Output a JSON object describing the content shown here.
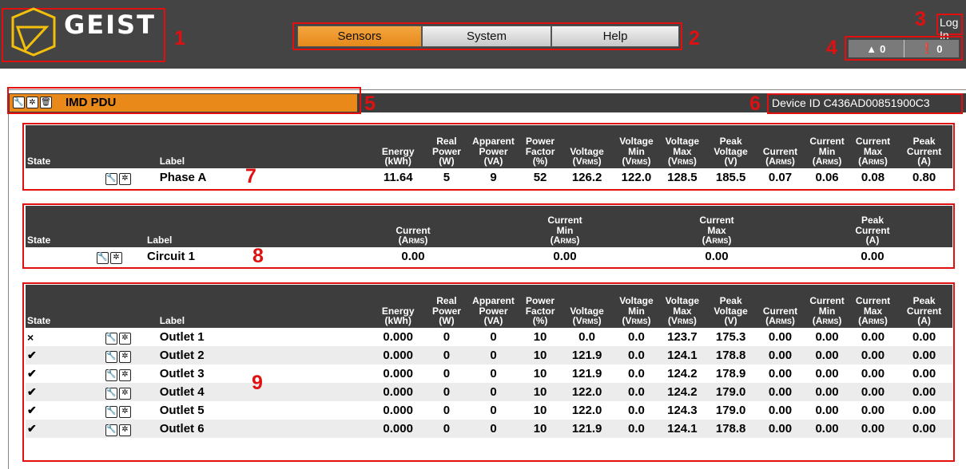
{
  "callouts": [
    "1",
    "2",
    "3",
    "4",
    "5",
    "6",
    "7",
    "8",
    "9"
  ],
  "brand": {
    "name": "GEIST",
    "logo_color": "#f2c00c"
  },
  "nav": {
    "tabs": [
      {
        "label": "Sensors",
        "active": true
      },
      {
        "label": "System",
        "active": false
      },
      {
        "label": "Help",
        "active": false
      }
    ]
  },
  "login": {
    "label": "Log In"
  },
  "alerts": {
    "warnings": "0",
    "alarms": "0",
    "warning_icon": "warning-triangle-icon",
    "alarm_icon": "exclamation-circle-icon"
  },
  "pdu": {
    "name": "IMD PDU",
    "device_id": "Device ID C436AD00851900C3",
    "icons": [
      "wrench-icon",
      "gear-icon",
      "trash-icon"
    ]
  },
  "phase_table": {
    "headers": {
      "state": "State",
      "label": "Label",
      "energy": [
        "Energy",
        "(kWh)"
      ],
      "real_power": [
        "Real",
        "Power",
        "(W)"
      ],
      "apparent_power": [
        "Apparent",
        "Power",
        "(VA)"
      ],
      "power_factor": [
        "Power",
        "Factor",
        "(%)"
      ],
      "voltage": [
        "Voltage",
        "(V",
        "RMS",
        ")"
      ],
      "voltage_min": [
        "Voltage",
        "Min",
        "(V",
        "RMS",
        ")"
      ],
      "voltage_max": [
        "Voltage",
        "Max",
        "(V",
        "RMS",
        ")"
      ],
      "peak_voltage": [
        "Peak",
        "Voltage",
        "(V)"
      ],
      "current": [
        "Current",
        "(A",
        "RMS",
        ")"
      ],
      "current_min": [
        "Current",
        "Min",
        "(A",
        "RMS",
        ")"
      ],
      "current_max": [
        "Current",
        "Max",
        "(A",
        "RMS",
        ")"
      ],
      "peak_current": [
        "Peak",
        "Current",
        "(A)"
      ]
    },
    "rows": [
      {
        "state": "",
        "label": "Phase A",
        "values": [
          "11.64",
          "5",
          "9",
          "52",
          "126.2",
          "122.0",
          "128.5",
          "185.5",
          "0.07",
          "0.06",
          "0.08",
          "0.80"
        ]
      }
    ]
  },
  "circuit_table": {
    "headers": {
      "state": "State",
      "label": "Label",
      "current": [
        "Current",
        "(A",
        "RMS",
        ")"
      ],
      "current_min": [
        "Current",
        "Min",
        "(A",
        "RMS",
        ")"
      ],
      "current_max": [
        "Current",
        "Max",
        "(A",
        "RMS",
        ")"
      ],
      "peak_current": [
        "Peak",
        "Current",
        "(A)"
      ]
    },
    "rows": [
      {
        "state": "",
        "label": "Circuit 1",
        "values": [
          "0.00",
          "0.00",
          "0.00",
          "0.00"
        ]
      }
    ]
  },
  "outlet_table": {
    "rows": [
      {
        "state": "×",
        "label": "Outlet 1",
        "values": [
          "0.000",
          "0",
          "0",
          "10",
          "0.0",
          "0.0",
          "123.7",
          "175.3",
          "0.00",
          "0.00",
          "0.00",
          "0.00"
        ]
      },
      {
        "state": "✔",
        "label": "Outlet 2",
        "values": [
          "0.000",
          "0",
          "0",
          "10",
          "121.9",
          "0.0",
          "124.1",
          "178.8",
          "0.00",
          "0.00",
          "0.00",
          "0.00"
        ]
      },
      {
        "state": "✔",
        "label": "Outlet 3",
        "values": [
          "0.000",
          "0",
          "0",
          "10",
          "121.9",
          "0.0",
          "124.2",
          "178.9",
          "0.00",
          "0.00",
          "0.00",
          "0.00"
        ]
      },
      {
        "state": "✔",
        "label": "Outlet 4",
        "values": [
          "0.000",
          "0",
          "0",
          "10",
          "122.0",
          "0.0",
          "124.2",
          "179.0",
          "0.00",
          "0.00",
          "0.00",
          "0.00"
        ]
      },
      {
        "state": "✔",
        "label": "Outlet 5",
        "values": [
          "0.000",
          "0",
          "0",
          "10",
          "122.0",
          "0.0",
          "124.3",
          "179.0",
          "0.00",
          "0.00",
          "0.00",
          "0.00"
        ]
      },
      {
        "state": "✔",
        "label": "Outlet 6",
        "values": [
          "0.000",
          "0",
          "0",
          "10",
          "121.9",
          "0.0",
          "124.1",
          "178.8",
          "0.00",
          "0.00",
          "0.00",
          "0.00"
        ]
      }
    ]
  },
  "colors": {
    "accent": "#e8891a",
    "header_bg": "#3d3d3d",
    "annotation": "#e01010"
  }
}
